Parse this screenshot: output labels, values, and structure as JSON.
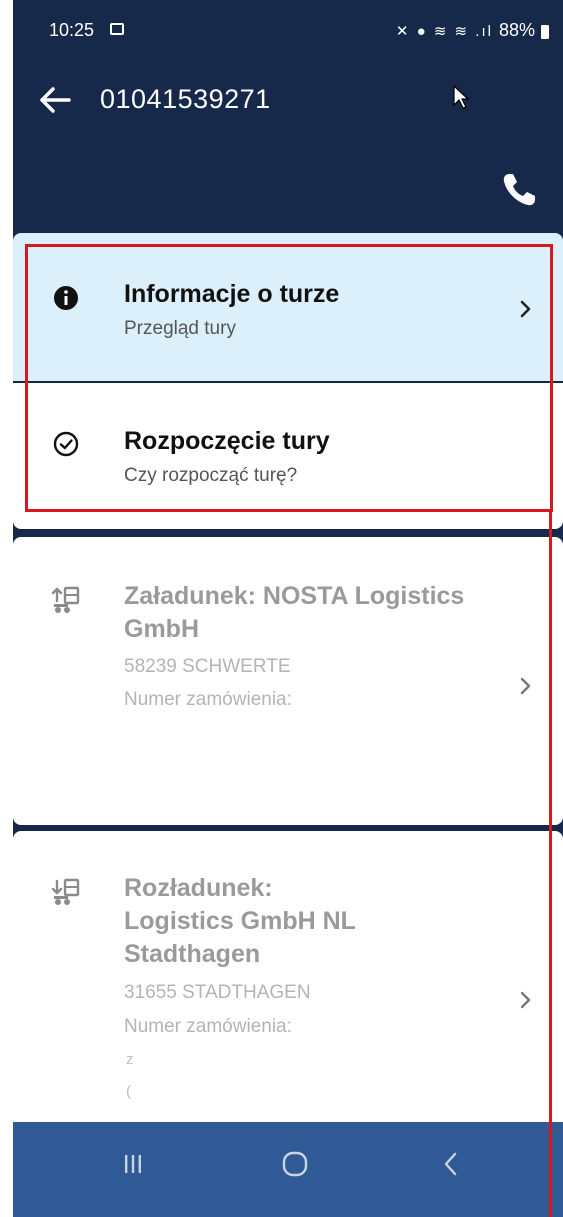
{
  "status_bar": {
    "time": "10:25",
    "icons": "✕ ● ≋ ≋ .ıl",
    "battery": "88%"
  },
  "app_bar": {
    "title": "01041539271"
  },
  "cards": {
    "tour_info": {
      "title": "Informacje o turze",
      "subtitle": "Przegląd tury"
    },
    "tour_start": {
      "title": "Rozpoczęcie tury",
      "subtitle": "Czy rozpocząć turę?"
    },
    "loading": {
      "title": "Załadunek: NOSTA Logistics GmbH",
      "address": "58239 SCHWERTE",
      "order": "Numer zamówienia:"
    },
    "unloading": {
      "title": "Rozładunek:\nLogistics GmbH NL Stadthagen",
      "address": "31655 STADTHAGEN",
      "order": "Numer zamówienia:",
      "fragment1": "z",
      "fragment2": "("
    }
  },
  "colors": {
    "app_bar_bg": "#16294a",
    "highlight_card_bg": "#dcf0fb",
    "nav_bar_bg": "#2f5a96",
    "annotation_red": "#d6181f",
    "disabled_text": "#9a9a9a"
  }
}
